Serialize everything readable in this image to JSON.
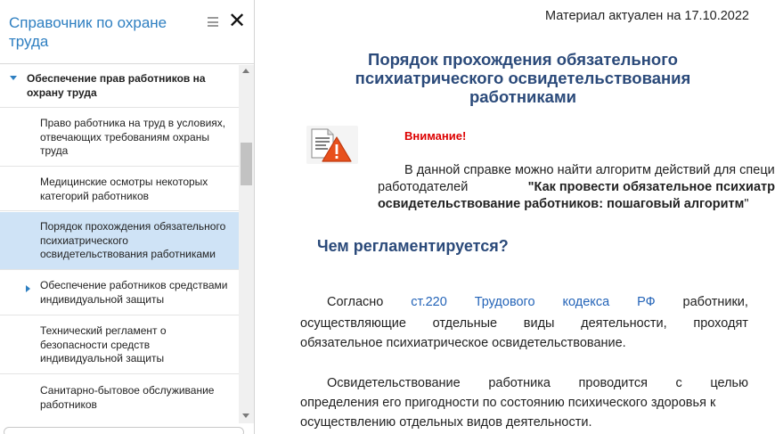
{
  "sidebar": {
    "title": "Справочник по охране труда",
    "items": [
      {
        "label": "Обеспечение прав работников на охрану труда"
      },
      {
        "label": "Право работника на труд в условиях, отвечающих требованиям охраны труда"
      },
      {
        "label": "Медицинские осмотры некоторых категорий работников"
      },
      {
        "label": "Порядок прохождения обязательного психиатрического освидетельствования работниками"
      },
      {
        "label": "Обеспечение работников средствами индивидуальной защиты"
      },
      {
        "label": "Технический регламент о безопасности средств индивидуальной защиты"
      },
      {
        "label": "Санитарно-бытовое обслуживание работников"
      }
    ]
  },
  "main": {
    "actual_date": "Материал актуален на 17.10.2022",
    "title": "Порядок прохождения обязательного психиатрического освидетельствования работниками",
    "warning": {
      "label": "Внимание!",
      "line1_text": "В данной справке можно найти алгоритм действий для специ",
      "line2_prefix": "работодателей",
      "line2_bold": "\"Как провести обязательное психиатр",
      "line3_bold": "освидетельствование работников: пошаговый алгоритм",
      "line3_suffix": "\""
    },
    "section_heading": "Чем регламентируется?",
    "para1": {
      "w1": "Согласно",
      "link1": "ст.220",
      "link2": "Трудового",
      "link3": "кодекса",
      "link4": "РФ",
      "w2": "работники,",
      "line2": [
        "осуществляющие",
        "отдельные",
        "виды",
        "деятельности,",
        "проходят"
      ],
      "line3": "обязательное психиатрическое освидетельствование."
    },
    "para2": {
      "line1": [
        "Освидетельствование",
        "работника",
        "проводится",
        "с",
        "целью"
      ],
      "line2": "определения его пригодности по состоянию психического здоровья к",
      "line3": "осуществлению отдельных видов деятельности."
    }
  },
  "colors": {
    "sidebar_title": "#2e7fc1",
    "heading": "#2b4a7a",
    "selected_bg": "#cfe3f6",
    "warning_red": "#dd0000",
    "link": "#2464b8"
  }
}
